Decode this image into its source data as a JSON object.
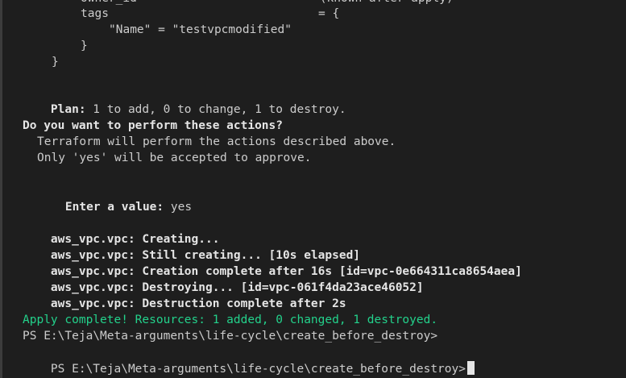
{
  "terminal": {
    "cut_top_line": "owner_id                        = (known after apply)",
    "tags_key": "tags",
    "tags_eq": "= {",
    "tags_entry": "\"Name\" = \"testvpcmodified\"",
    "close_inner": "}",
    "close_outer": "}",
    "plan_label": "Plan:",
    "plan_text": " 1 to add, 0 to change, 1 to destroy.",
    "question": "Do you want to perform these actions?",
    "info1": "Terraform will perform the actions described above.",
    "info2": "Only 'yes' will be accepted to approve.",
    "enter_label": "Enter a value:",
    "enter_value": " yes",
    "log": [
      {
        "prefix": "aws_vpc.vpc:",
        "text": " Creating..."
      },
      {
        "prefix": "aws_vpc.vpc:",
        "text": " Still creating... [10s elapsed]"
      },
      {
        "prefix": "aws_vpc.vpc:",
        "text": " Creation complete after 16s [id=vpc-0e664311ca8654aea]"
      },
      {
        "prefix": "aws_vpc.vpc:",
        "text": " Destroying... [id=vpc-061f4da23ace46052]"
      },
      {
        "prefix": "aws_vpc.vpc:",
        "text": " Destruction complete after 2s"
      }
    ],
    "apply_complete": "Apply complete! Resources: 1 added, 0 changed, 1 destroyed.",
    "prompt1": "PS E:\\Teja\\Meta-arguments\\life-cycle\\create_before_destroy>",
    "prompt2": "PS E:\\Teja\\Meta-arguments\\life-cycle\\create_before_destroy>"
  },
  "colors": {
    "background": "#1e1e1e",
    "text": "#cccccc",
    "bold_text": "#e5e5e5",
    "success_green": "#23d18b"
  }
}
